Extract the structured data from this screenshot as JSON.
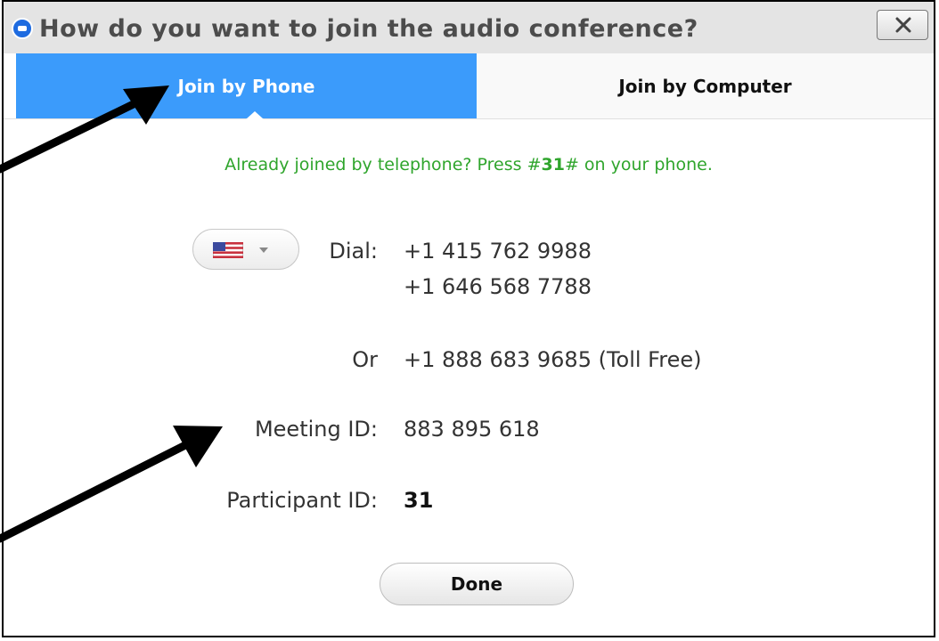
{
  "window": {
    "title": "How do you want to join the audio conference?"
  },
  "tabs": [
    {
      "label": "Join by Phone",
      "active": true
    },
    {
      "label": "Join by Computer",
      "active": false
    }
  ],
  "notice": {
    "prefix": "Already joined by telephone? Press #",
    "code": "31",
    "suffix": "# on your phone."
  },
  "dial": {
    "label": "Dial:",
    "numbers": [
      "+1 415 762 9988",
      "+1 646 568 7788"
    ],
    "country_icon": "us-flag-icon"
  },
  "or": {
    "label": "Or",
    "number": "+1 888 683 9685 (Toll Free)"
  },
  "meeting": {
    "label": "Meeting ID:",
    "value": "883 895 618"
  },
  "participant": {
    "label": "Participant ID:",
    "value": "31"
  },
  "done_label": "Done",
  "colors": {
    "active_tab": "#3b9bfb",
    "notice_green": "#2fa52c",
    "logo_blue": "#1e6be0"
  }
}
